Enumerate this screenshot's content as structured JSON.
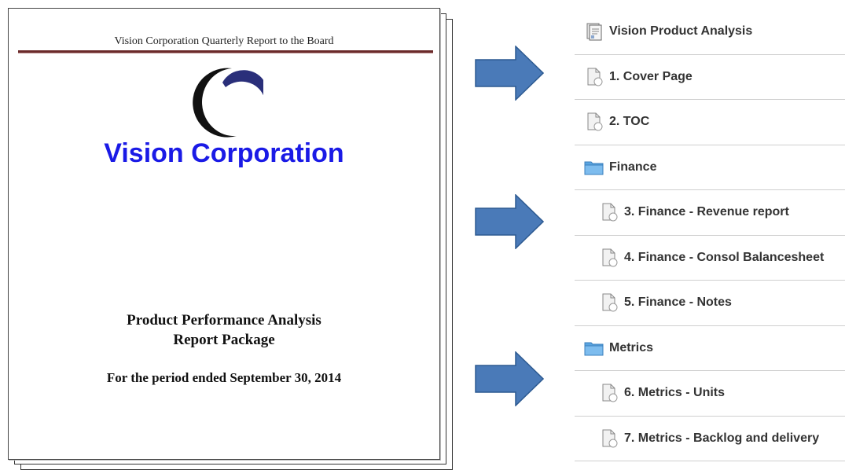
{
  "document": {
    "header": "Vision Corporation Quarterly Report to the Board",
    "company": "Vision Corporation",
    "title_line1": "Product Performance Analysis",
    "title_line2": "Report Package",
    "period": "For the period ended September 30, 2014",
    "company_color": "#1a1ae6",
    "rule_color": "#6b2a2a"
  },
  "arrow_color": "#4a7ab8",
  "tree": [
    {
      "label": "Vision Product Analysis",
      "icon": "report-book-icon",
      "level": 1
    },
    {
      "label": "1. Cover Page",
      "icon": "document-icon",
      "level": 1
    },
    {
      "label": "2. TOC",
      "icon": "document-icon",
      "level": 1
    },
    {
      "label": "Finance",
      "icon": "folder-icon",
      "level": 1
    },
    {
      "label": "3. Finance - Revenue report",
      "icon": "document-icon",
      "level": 2
    },
    {
      "label": "4. Finance - Consol Balancesheet",
      "icon": "document-icon",
      "level": 2
    },
    {
      "label": "5. Finance - Notes",
      "icon": "document-icon",
      "level": 2
    },
    {
      "label": "Metrics",
      "icon": "folder-icon",
      "level": 1
    },
    {
      "label": "6. Metrics - Units",
      "icon": "document-icon",
      "level": 2
    },
    {
      "label": "7. Metrics - Backlog and delivery",
      "icon": "document-icon",
      "level": 2
    }
  ]
}
